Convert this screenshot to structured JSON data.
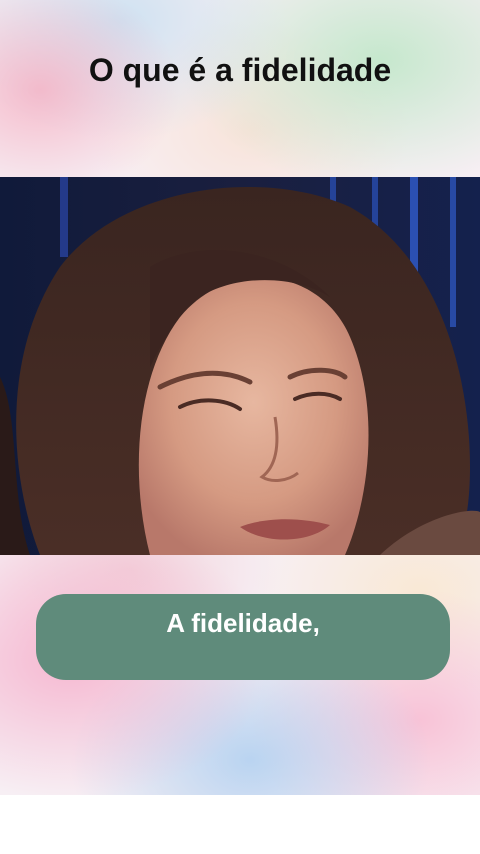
{
  "header": {
    "title": "O que é a fidelidade"
  },
  "caption": {
    "text": "A fidelidade,"
  },
  "colors": {
    "caption_background": "#5f8b7b",
    "title_text": "#111111",
    "caption_text": "#ffffff"
  }
}
